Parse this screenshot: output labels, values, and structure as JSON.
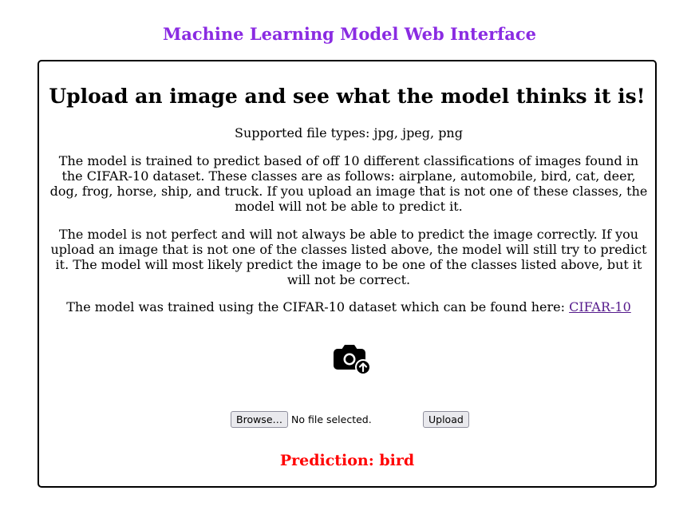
{
  "header": {
    "title": "Machine Learning Model Web Interface"
  },
  "card": {
    "heading": "Upload an image and see what the model thinks it is!",
    "supported_types": "Supported file types: jpg, jpeg, png",
    "classes_text": "The model is trained to predict based of off 10 different classifications of images found in the CIFAR-10 dataset. These classes are as follows: airplane, automobile, bird, cat, deer, dog, frog, horse, ship, and truck. If you upload an image that is not one of these classes, the model will not be able to predict it.",
    "imperfect_text": "The model is not perfect and will not always be able to predict the image correctly. If you upload an image that is not one of the classes listed above, the model will still try to predict it. The model will most likely predict the image to be one of the classes listed above, but it will not be correct.",
    "source_text": "The model was trained using the CIFAR-10 dataset which can be found here: ",
    "source_link": "CIFAR-10",
    "upload_icon": "camera-upload-icon",
    "file_input": {
      "browse_label": "Browse…",
      "status": "No file selected."
    },
    "upload_label": "Upload",
    "prediction": "Prediction: bird"
  },
  "colors": {
    "title": "#8a2be2",
    "prediction": "#ff0000",
    "link": "#551a8b"
  }
}
